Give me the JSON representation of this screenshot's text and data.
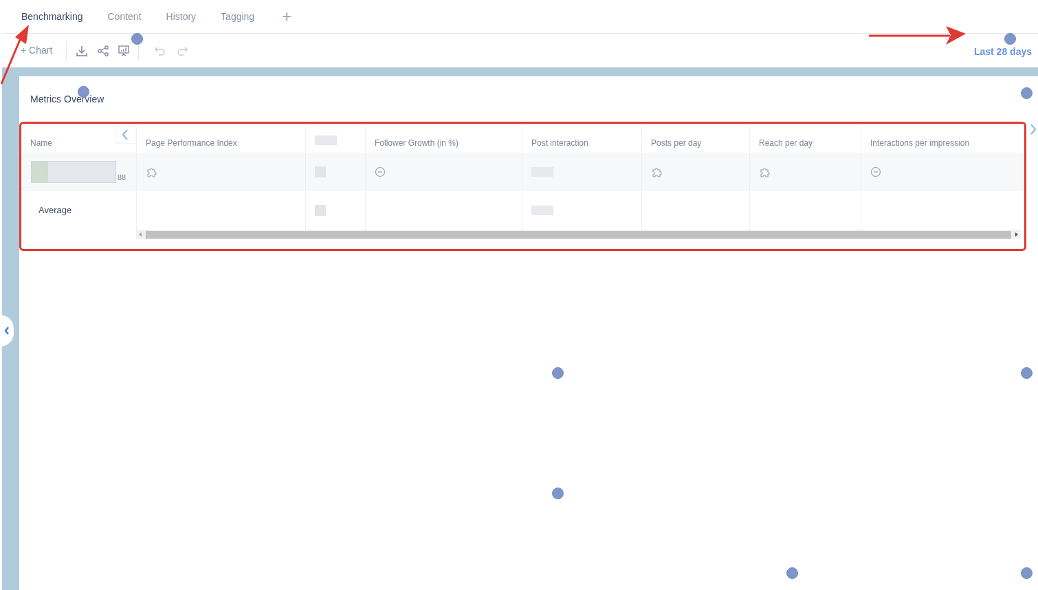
{
  "tabs": [
    {
      "label": "Benchmarking",
      "selected": true
    },
    {
      "label": "Content",
      "selected": false
    },
    {
      "label": "History",
      "selected": false
    },
    {
      "label": "Tagging",
      "selected": false
    }
  ],
  "add_tab": "+",
  "toolbar": {
    "add_chart": "+ Chart",
    "date_range": "Last 28 days"
  },
  "panel": {
    "title": "Metrics Overview",
    "table": {
      "columns": [
        {
          "kind": "text",
          "label": "Name"
        },
        {
          "kind": "text",
          "label": "Page Performance Index"
        },
        {
          "kind": "blurred"
        },
        {
          "kind": "text",
          "label": "Follower Growth (in %)"
        },
        {
          "kind": "text",
          "label": "Post interaction"
        },
        {
          "kind": "text",
          "label": "Posts per day"
        },
        {
          "kind": "text",
          "label": "Reach per day"
        },
        {
          "kind": "text",
          "label": "Interactions per impression"
        }
      ],
      "rows": [
        {
          "kind": "page",
          "count": "88",
          "cells": [
            {
              "kind": "puzzle"
            },
            {
              "kind": "blurred"
            },
            {
              "kind": "minus"
            },
            {
              "kind": "blurred"
            },
            {
              "kind": "puzzle"
            },
            {
              "kind": "puzzle"
            },
            {
              "kind": "minus"
            }
          ]
        },
        {
          "kind": "average",
          "name": "Average",
          "cells": [
            {
              "kind": "empty"
            },
            {
              "kind": "blurred"
            },
            {
              "kind": "empty"
            },
            {
              "kind": "blurred"
            },
            {
              "kind": "empty"
            },
            {
              "kind": "empty"
            },
            {
              "kind": "empty"
            }
          ]
        }
      ]
    }
  }
}
